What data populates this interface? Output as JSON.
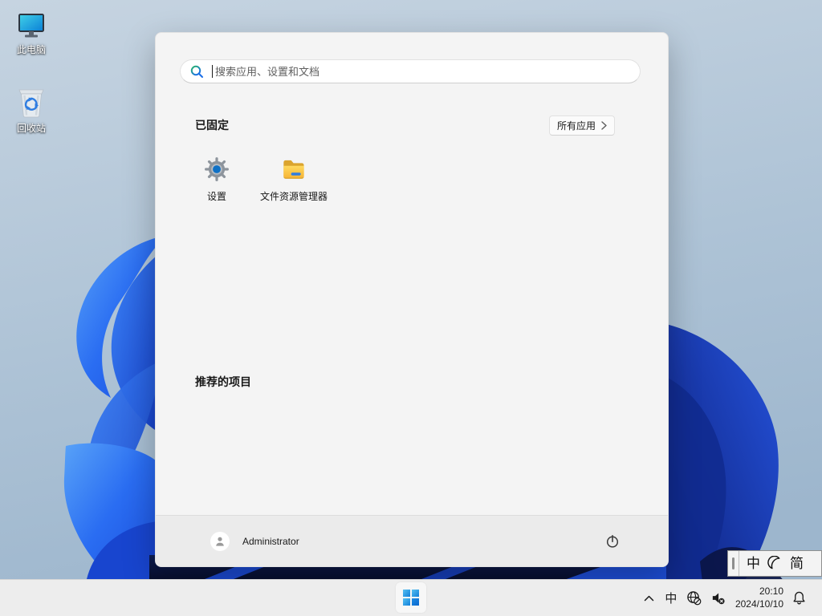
{
  "desktop": {
    "icons": [
      {
        "label": "此电脑"
      },
      {
        "label": "回收站"
      }
    ]
  },
  "start_menu": {
    "search_placeholder": "搜索应用、设置和文档",
    "pinned_title": "已固定",
    "all_apps_label": "所有应用",
    "pinned_apps": [
      {
        "label": "设置"
      },
      {
        "label": "文件资源管理器"
      }
    ],
    "recommended_title": "推荐的项目",
    "user_name": "Administrator"
  },
  "ime_bar": {
    "mode_chinese": "中",
    "mode_simplified": "简"
  },
  "taskbar": {
    "tray_ime": "中",
    "time": "20:10",
    "date": "2024/10/10"
  },
  "colors": {
    "accent_blue": "#0078d4",
    "petal_bright": "#2a6df2",
    "petal_dark": "#16339f",
    "menu_bg": "#f4f4f4",
    "taskbar_bg": "#ededed"
  }
}
